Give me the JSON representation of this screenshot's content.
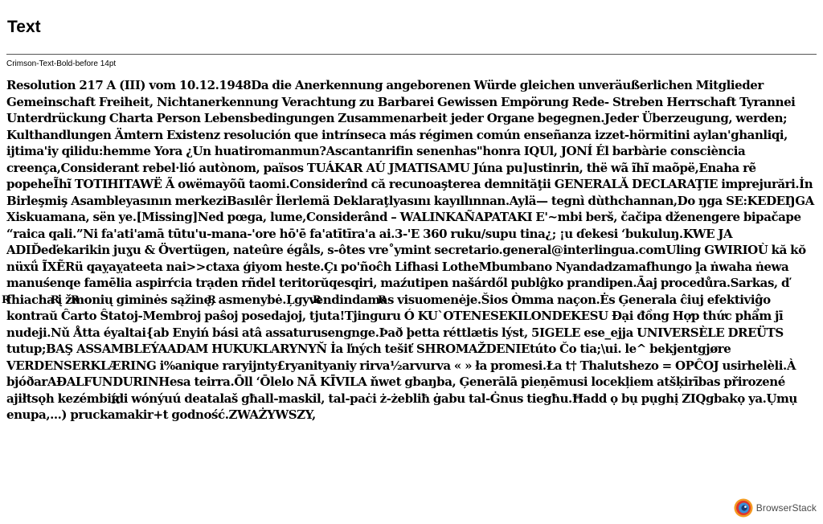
{
  "page": {
    "title": "Text",
    "caption": "Crimson-Text-Bold-before 14pt"
  },
  "content": {
    "body": "Resolution 217 A (III) vom 10.12.1948Da die Anerkennung angeborenen Würde gleichen unveräußerlichen Mitglieder Gemeinschaft Freiheit, Nichtanerkennung Verachtung zu Barbarei Gewissen Empörung Rede- Streben Herrschaft Tyrannei Unterdrückung Charta Person Lebensbedingungen Zusammenarbeit jeder Organe begegnen.Jeder Überzeugung, werden; Kulthandlungen Ämtern Existenz resolución que intrínseca más régimen común enseñanza izzet-hörmitini aylan'ghanliqi, ijtima'iy qilidu:hemme Yora ¿Un huatiromanmun?Ascantanrifin senenhas\"honra IQUl, JONÍ Él barbàrie consciència creença,Considerant rebel·lió autònom, països TUÁKAR AÚ JMATISAMU Júna pu]ustinrin, thë wã ĩhĩ maõpë,Enaha rẽ popeheĨhĩ TOTIHITAWË Ã owëmayõũ taomi.Considerînd că recunoaşterea demnităţii GENERALĂ DECLARAŢIE imprejurări.İn Birleşmiş Asambleyasının merkeziBasılêr İlerlemä Deklaraţlyasını kayıllınnan.Aylä— tegnì dùthchannan,Do ŋga SE:KEDEŊGA Xiskuamana, sën ye.[Missing]Ned pœga, lume,Considerând – WALINKAÑAPATAKI E'~mbi berš, čačipa dženengere bipačape “raica qali.”Ni fa'ati'amā tūtu'u-mana-'ore hō'ē fa'atītīra'a ai.3-'E 360 ruku/supu tina¿; ¡u ɗekesi ʻbukuluŋ.KWE JA ADIĎeďekarikin juɣu & Övertügen, nateûre égåls, s-ôtes vre˚ymint secretario.general@interlingua.comUling GWIRIOÙ kă kŏ nüxǘ ĨXẼRü qaỵaỵateeta nai>>ctaxa ģiyom heste.Çı po'ñoĉh Lifhasi LotheMbumbano Nyandadzamafhungo ḽa ṅwaha ṅewa manuśenqe famēlia aspirŕcia trạden rñdel teritorŭqesqiri, maźutipen našárdől publĝko prandipen.Āaj procedůra.Sarkas, ď fhiacha į žmonių giminės sąžinę, asmenybė.Ļgyvendindamas visuomenėje.Šios Òmma naçon.Ės Ģenerala ĉiuj efektiviĝo kontraŭ Ĉarto Ŝtatoj-Membroj paŝoj posedajoj, tjuta!Tjinguru Ó KU`OTENESEKILONDEKESU Đại đồng Hợp thức phẩm jī nudeji.Nǔ Åtta éyaltai{ab Enyiń bási atâ assaturusengnge.Það þetta réttlætis lýst, 5IGELE ese_ejja UNIVERSÈLE DREÜTS tutup;BAŞ ASSAMBLEÝAADAM HUKUKLARYNYŇ İa ľných tešiť SHROMAŽDENIEtúto Čo tia;\\ui. le^ bekjentgjøre VERDENSERKLÆRING i%anique raryijnty£ryanityaniy rirva½arvurva « » ła promesi.Ła t† Thalutshezo = OPĈOJ usirhelèli.À bjóðarAĐALFUNDURINHesa teirra.Ōll ʻŌlelo NĀ KĪVILA ňwet gbaŋba, Ģenerālā pieņēmusi locekļiem atšķirības přirozené ajiłtsǫh kezémbiídi wónýuú deatalaš għall-maskil, tal-paċi ż-żebliħ ġabu tal-Ġnus tiegħu.Ħadd ọ bụ pụghị ZIQgbakọ ya.Ụmụ enupa,...) pruckamakir+t godność.ZWAŻYWSZY,",
    "stray_glyph": "R"
  },
  "branding": {
    "logo_text": "BrowserStack",
    "logo_icon": "browserstack-eye-icon",
    "colors": {
      "outer": "#f39a21",
      "mid": "#e0342b",
      "inner": "#3b8fd8",
      "core": "#1a3a73",
      "highlight": "#ffffff"
    }
  }
}
